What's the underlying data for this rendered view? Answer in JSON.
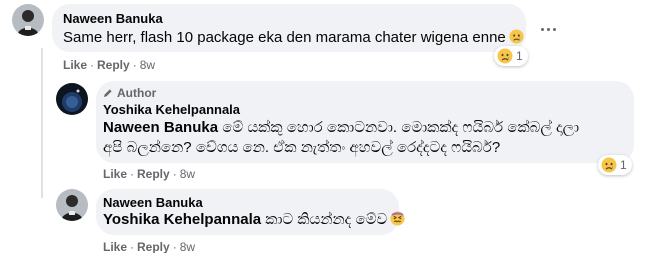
{
  "comments": [
    {
      "author": "Naween Banuka",
      "text": "Same herr, flash 10 package eka den marama chater wigena enne",
      "reaction_count": "1",
      "actions": {
        "like": "Like",
        "reply": "Reply",
        "time": "8w"
      }
    },
    {
      "badge": "Author",
      "author": "Yoshika Kehelpannala",
      "mention": "Naween Banuka",
      "text": "මේ යක්කු හොර කොටනවා. මොකක්ද ෆයිබර් කේබල් දාලා අපි බලන්නෙ? වේගය නෙ. ඒක නැත්තං අහවල් රෙද්දටද ෆයිබර්?",
      "reaction_count": "1",
      "actions": {
        "like": "Like",
        "reply": "Reply",
        "time": "8w"
      }
    },
    {
      "author": "Naween Banuka",
      "mention": "Yoshika Kehelpannala",
      "text": "කාට කියන්නද මේව",
      "actions": {
        "like": "Like",
        "reply": "Reply",
        "time": "8w"
      }
    }
  ],
  "colors": {
    "bubble": "#f0f2f5",
    "secondary_text": "#65676b",
    "primary_text": "#050505"
  },
  "icons": [
    "sad-emoji-icon",
    "confounded-emoji-icon",
    "more-options-icon",
    "pencil-icon"
  ]
}
